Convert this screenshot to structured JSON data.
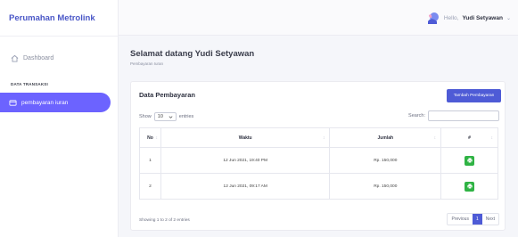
{
  "brand": "Perumahan Metrolink",
  "sidebar": {
    "dashboard_label": "Dashboard",
    "section_label": "DATA TRANSAKSI",
    "active_item_label": "pembayaran iuran"
  },
  "topbar": {
    "greeting": "Hello,",
    "user_name": "Yudi Setyawan",
    "chevron": "⌄"
  },
  "page": {
    "welcome": "Selamat datang Yudi Setyawan",
    "breadcrumb": "Pembayaran Iuran"
  },
  "card": {
    "title": "Data Pembayaran",
    "add_button": "Tambah Pembayaran",
    "show_label": "Show",
    "entries_value": "10",
    "entries_label": "entries",
    "search_label": "Search:",
    "search_value": ""
  },
  "table": {
    "headers": [
      "No",
      "Waktu",
      "Jumlah",
      "#"
    ],
    "rows": [
      {
        "no": "1",
        "waktu": "12 Jun 2021, 19:40 PM",
        "jumlah": "Rp. 150,000"
      },
      {
        "no": "2",
        "waktu": "12 Jun 2021, 09:17 AM",
        "jumlah": "Rp. 150,000"
      }
    ]
  },
  "footer": {
    "info": "Showing 1 to 2 of 2 entries",
    "previous": "Previous",
    "current_page": "1",
    "next": "Next"
  },
  "colors": {
    "brand": "#4a57c7",
    "active_nav": "#6c63ff",
    "primary_button": "#4e5bd6",
    "action_button": "#2fb344"
  },
  "icons": {
    "dashboard": "home-icon",
    "active_nav": "credit-card-icon",
    "action": "printer-icon",
    "avatar": "user-avatar-icon"
  }
}
